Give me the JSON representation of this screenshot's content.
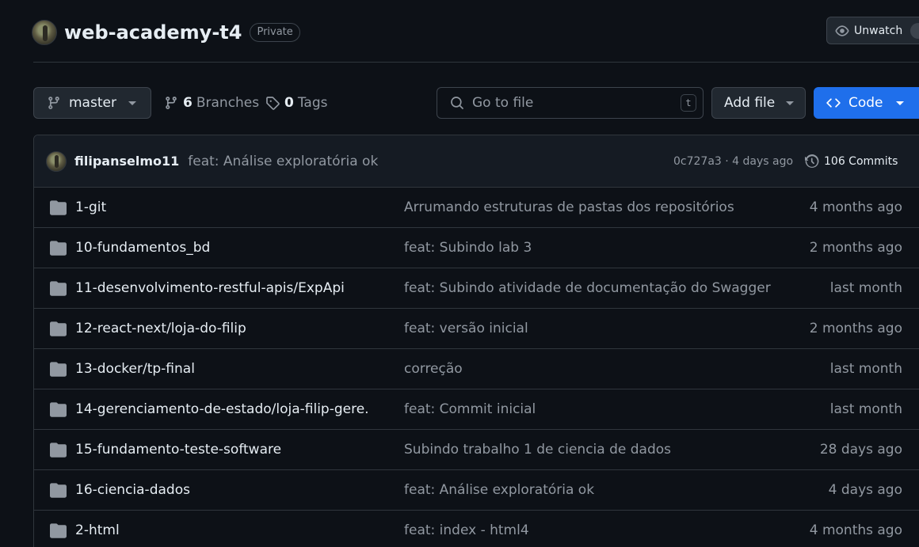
{
  "repo": {
    "name": "web-academy-t4",
    "visibility": "Private",
    "watch_label": "Unwatch"
  },
  "toolbar": {
    "branch": "master",
    "branches_count": "6",
    "branches_label": "Branches",
    "tags_count": "0",
    "tags_label": "Tags",
    "search_placeholder": "Go to file",
    "search_shortcut": "t",
    "add_file_label": "Add file",
    "code_label": "Code"
  },
  "latest_commit": {
    "author": "filipanselmo11",
    "message": "feat: Análise exploratória ok",
    "meta": "0c727a3 · 4 days ago",
    "commits_label": "106 Commits"
  },
  "files": [
    {
      "name": "1-git",
      "message": "Arrumando estruturas de pastas dos repositórios",
      "date": "4 months ago"
    },
    {
      "name": "10-fundamentos_bd",
      "message": "feat: Subindo lab 3",
      "date": "2 months ago"
    },
    {
      "name": "11-desenvolvimento-restful-apis/ExpApi",
      "message": "feat: Subindo atividade de documentação do Swagger",
      "date": "last month"
    },
    {
      "name": "12-react-next/loja-do-filip",
      "message": "feat: versão inicial",
      "date": "2 months ago"
    },
    {
      "name": "13-docker/tp-final",
      "message": "correção",
      "date": "last month"
    },
    {
      "name": "14-gerenciamento-de-estado/loja-filip-gere...",
      "message": "feat: Commit inicial",
      "date": "last month"
    },
    {
      "name": "15-fundamento-teste-software",
      "message": "Subindo trabalho 1 de ciencia de dados",
      "date": "28 days ago"
    },
    {
      "name": "16-ciencia-dados",
      "message": "feat: Análise exploratória ok",
      "date": "4 days ago"
    },
    {
      "name": "2-html",
      "message": "feat: index - html4",
      "date": "4 months ago"
    }
  ],
  "icons": {
    "folder": "folder-icon",
    "branch": "git-branch-icon",
    "tag": "tag-icon",
    "search": "search-icon",
    "eye": "eye-icon",
    "code": "code-icon",
    "history": "history-icon"
  },
  "colors": {
    "background": "#0d1117",
    "primary_button": "#1f6feb",
    "muted_text": "#9198a1"
  }
}
